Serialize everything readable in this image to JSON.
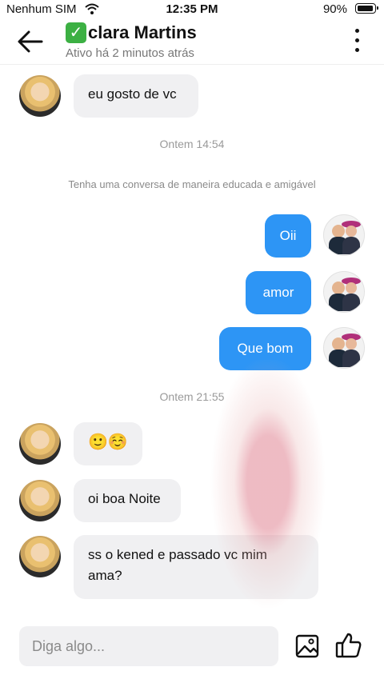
{
  "status_bar": {
    "carrier": "Nenhum SIM",
    "time": "12:35 PM",
    "battery": "90%"
  },
  "header": {
    "verified_mark": "✓",
    "name": "clara Martins",
    "subtitle": "Ativo há 2 minutos atrás"
  },
  "messages": [
    {
      "side": "in",
      "text": "eu gosto de vc"
    },
    {
      "type": "timestamp",
      "text": "Ontem 14:54"
    },
    {
      "type": "notice",
      "text": "Tenha uma conversa de maneira educada e amigável"
    },
    {
      "side": "out",
      "text": "Oii"
    },
    {
      "side": "out",
      "text": "amor"
    },
    {
      "side": "out",
      "text": "Que bom"
    },
    {
      "type": "timestamp",
      "text": "Ontem 21:55"
    },
    {
      "side": "in",
      "text": "🙂☺️"
    },
    {
      "side": "in",
      "text": "oi boa Noite"
    },
    {
      "side": "in",
      "text": "ss o kened e passado vc mim ama?"
    }
  ],
  "composer": {
    "placeholder": "Diga algo..."
  },
  "icons": {
    "back": "arrow-left-icon",
    "more": "more-vertical-icon",
    "image": "image-icon",
    "like": "thumbs-up-icon"
  },
  "colors": {
    "outgoing_bubble": "#2d95f5",
    "incoming_bubble": "#f0f0f2",
    "verified": "#3cb043"
  }
}
